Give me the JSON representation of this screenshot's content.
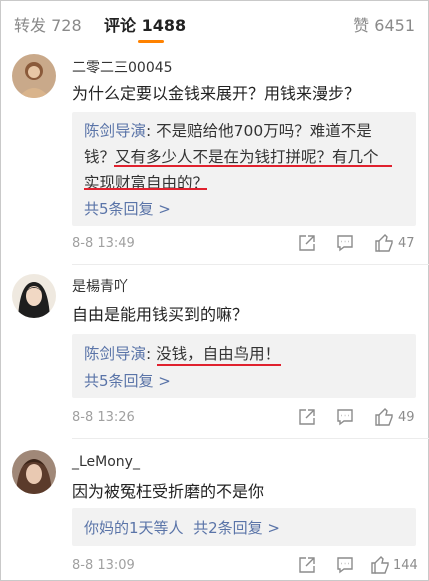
{
  "tabs": {
    "repost": {
      "label": "转发",
      "count": "728"
    },
    "comment": {
      "label": "评论",
      "count": "1488"
    },
    "like": {
      "label": "赞",
      "count": "6451"
    }
  },
  "comments": [
    {
      "username": "二零二三00045",
      "text": "为什么定要以金钱来展开？用钱来漫步？",
      "reply": {
        "author": "陈剑导演",
        "line1": ": 不是赔给他700万吗？难道不是",
        "line2": "钱？又有多少人不是在为钱打拼呢？有几个",
        "line3": "实现财富自由的？"
      },
      "more_replies": "共5条回复 >",
      "time": "8-8 13:49",
      "likes": "47"
    },
    {
      "username": "是楊青吖",
      "text": "自由是能用钱买到的嘛？",
      "reply": {
        "author": "陈剑导演",
        "line1": ": 没钱，自由鸟用！"
      },
      "more_replies": "共5条回复 >",
      "time": "8-8 13:26",
      "likes": "49"
    },
    {
      "username": "_LeMony_",
      "text": "因为被冤枉受折磨的不是你",
      "reply": {
        "liked_by": "你妈的1天等人",
        "more_replies": "共2条回复 >"
      },
      "time": "8-8 13:09",
      "likes": "144"
    }
  ],
  "colors": {
    "accent": "#ff8200",
    "link": "#5a74a8",
    "highlight": "#e0212e"
  },
  "icons": [
    "share-icon",
    "comment-icon",
    "thumbs-up-icon"
  ]
}
